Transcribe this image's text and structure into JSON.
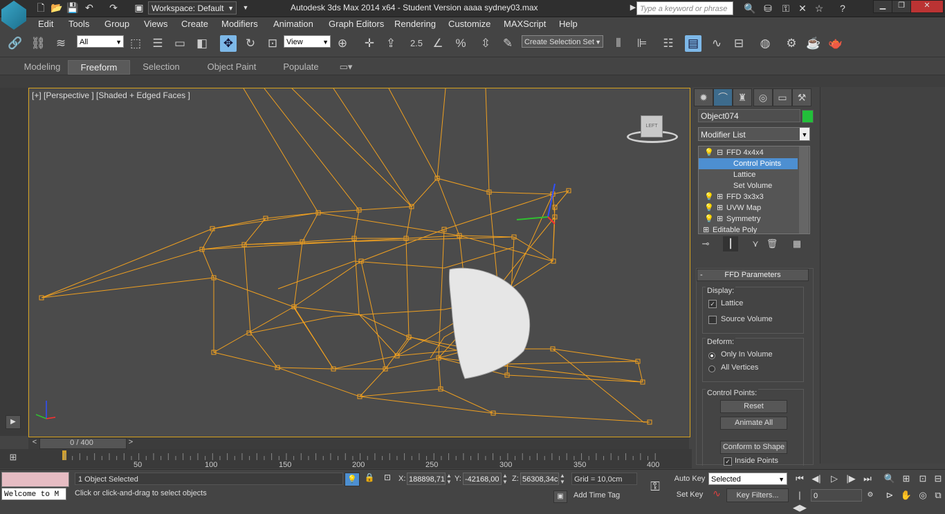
{
  "titlebar": {
    "workspace": "Workspace: Default",
    "app_title": "Autodesk 3ds Max  2014 x64  - Student Version      aaaa sydney03.max",
    "search_placeholder": "Type a keyword or phrase"
  },
  "menu": [
    "Edit",
    "Tools",
    "Group",
    "Views",
    "Create",
    "Modifiers",
    "Animation",
    "Graph Editors",
    "Rendering",
    "Customize",
    "MAXScript",
    "Help"
  ],
  "toolbar": {
    "filter": "All",
    "ref_coord": "View",
    "angle_snap": "2.5",
    "selection_set_placeholder": "Create Selection Set"
  },
  "ribbon": {
    "tabs": [
      "Modeling",
      "Freeform",
      "Selection",
      "Object Paint",
      "Populate"
    ],
    "active": "Freeform"
  },
  "viewport": {
    "label": "[+] [Perspective ] [Shaded + Edged Faces ]",
    "viewcube_face": "LEFT"
  },
  "command_panel": {
    "object_name": "Object074",
    "object_color": "#22c03a",
    "modifier_list": "Modifier List",
    "stack": [
      {
        "label": "FFD 4x4x4",
        "level": 0
      },
      {
        "label": "Control Points",
        "level": 1,
        "selected": true
      },
      {
        "label": "Lattice",
        "level": 1
      },
      {
        "label": "Set Volume",
        "level": 1
      },
      {
        "label": "FFD 3x3x3",
        "level": 0
      },
      {
        "label": "UVW Map",
        "level": 0
      },
      {
        "label": "Symmetry",
        "level": 0
      },
      {
        "label": "Editable Poly",
        "level": 0
      }
    ],
    "ffd": {
      "title": "FFD Parameters",
      "display_title": "Display:",
      "lattice": "Lattice",
      "source_volume": "Source Volume",
      "deform_title": "Deform:",
      "only_in_volume": "Only In Volume",
      "all_vertices": "All Vertices",
      "control_points_title": "Control Points:",
      "reset": "Reset",
      "animate_all": "Animate All",
      "conform": "Conform to Shape",
      "inside_points": "Inside Points"
    }
  },
  "timeline": {
    "frame": "0 / 400",
    "ticks": [
      "50",
      "100",
      "150",
      "200",
      "250",
      "300",
      "350",
      "400"
    ]
  },
  "status": {
    "welcome": "Welcome to M",
    "selected": "1 Object Selected",
    "prompt": "Click or click-and-drag to select objects",
    "x_label": "X:",
    "x": "188898,71",
    "y_label": "Y:",
    "y": "-42168,00",
    "z_label": "Z:",
    "z": "56308,34c",
    "grid": "Grid = 10,0cm",
    "add_time_tag": "Add Time Tag",
    "auto_key": "Auto Key",
    "set_key": "Set Key",
    "selected_dd": "Selected",
    "key_filters": "Key Filters...",
    "frame_field": "0"
  }
}
